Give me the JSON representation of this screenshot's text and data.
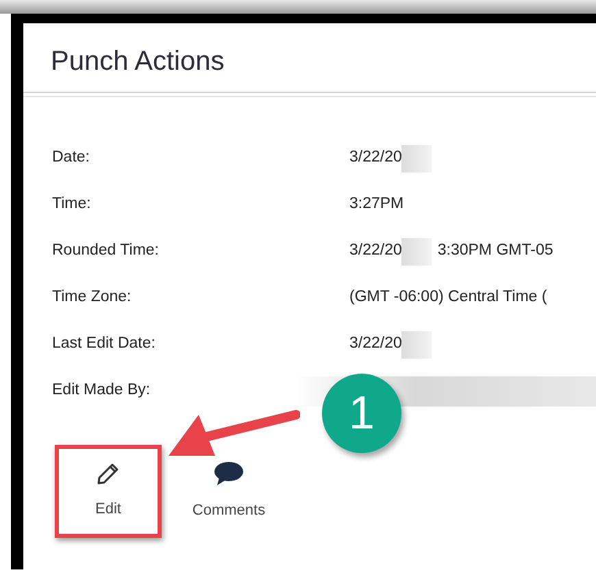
{
  "title": "Punch Actions",
  "fields": [
    {
      "label": "Date:",
      "value": "3/22/20",
      "redacted": true
    },
    {
      "label": "Time:",
      "value": "3:27PM",
      "redacted": false
    },
    {
      "label": "Rounded Time:",
      "value": "3/22/20",
      "redacted": true,
      "value_after": "3:30PM GMT-05"
    },
    {
      "label": "Time Zone:",
      "value": "(GMT -06:00) Central Time (",
      "redacted": false
    },
    {
      "label": "Last Edit Date:",
      "value": "3/22/20",
      "redacted": true
    },
    {
      "label": "Edit Made By:",
      "redacted": true
    }
  ],
  "actions": [
    {
      "label": "Edit",
      "kind": "pencil",
      "highlighted": true
    },
    {
      "label": "Comments",
      "kind": "speech",
      "highlighted": false
    }
  ],
  "callout": {
    "number": "1"
  }
}
